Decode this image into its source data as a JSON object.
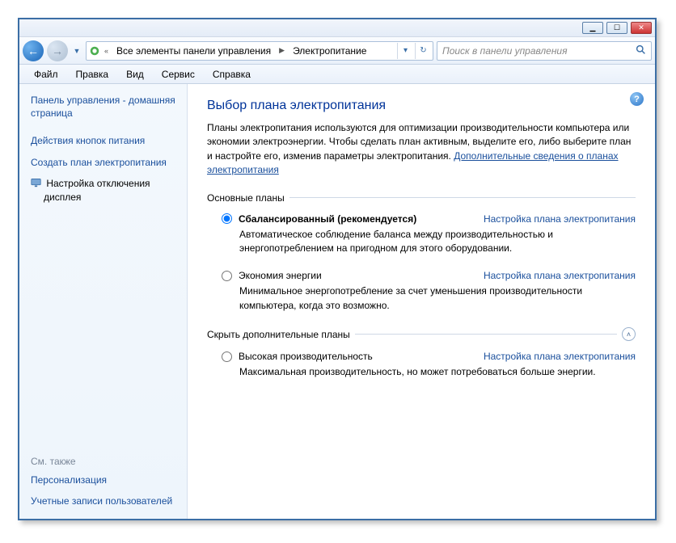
{
  "breadcrumb": {
    "parent": "Все элементы панели управления",
    "current": "Электропитание"
  },
  "search": {
    "placeholder": "Поиск в панели управления"
  },
  "menu": {
    "file": "Файл",
    "edit": "Правка",
    "view": "Вид",
    "service": "Сервис",
    "help": "Справка"
  },
  "sidebar": {
    "home": "Панель управления - домашняя страница",
    "power_buttons": "Действия кнопок питания",
    "create_plan": "Создать план электропитания",
    "display_off": "Настройка отключения дисплея",
    "see_also": "См. также",
    "personalization": "Персонализация",
    "user_accounts": "Учетные записи пользователей"
  },
  "main": {
    "title": "Выбор плана электропитания",
    "intro_a": "Планы электропитания используются для оптимизации производительности компьютера или экономии электроэнергии. Чтобы сделать план активным, выделите его, либо выберите план и настройте его, изменив параметры электропитания. ",
    "intro_link": "Дополнительные сведения о планах электропитания",
    "section_basic": "Основные планы",
    "section_extra": "Скрыть дополнительные планы",
    "plan_settings_link": "Настройка плана электропитания",
    "plans": {
      "balanced": {
        "name": "Сбалансированный (рекомендуется)",
        "desc": "Автоматическое соблюдение баланса между производительностью и энергопотреблением на пригодном для этого оборудовании."
      },
      "saver": {
        "name": "Экономия энергии",
        "desc": "Минимальное энергопотребление за счет уменьшения производительности компьютера, когда это возможно."
      },
      "high": {
        "name": "Высокая производительность",
        "desc": "Максимальная производительность, но может потребоваться больше энергии."
      }
    }
  }
}
